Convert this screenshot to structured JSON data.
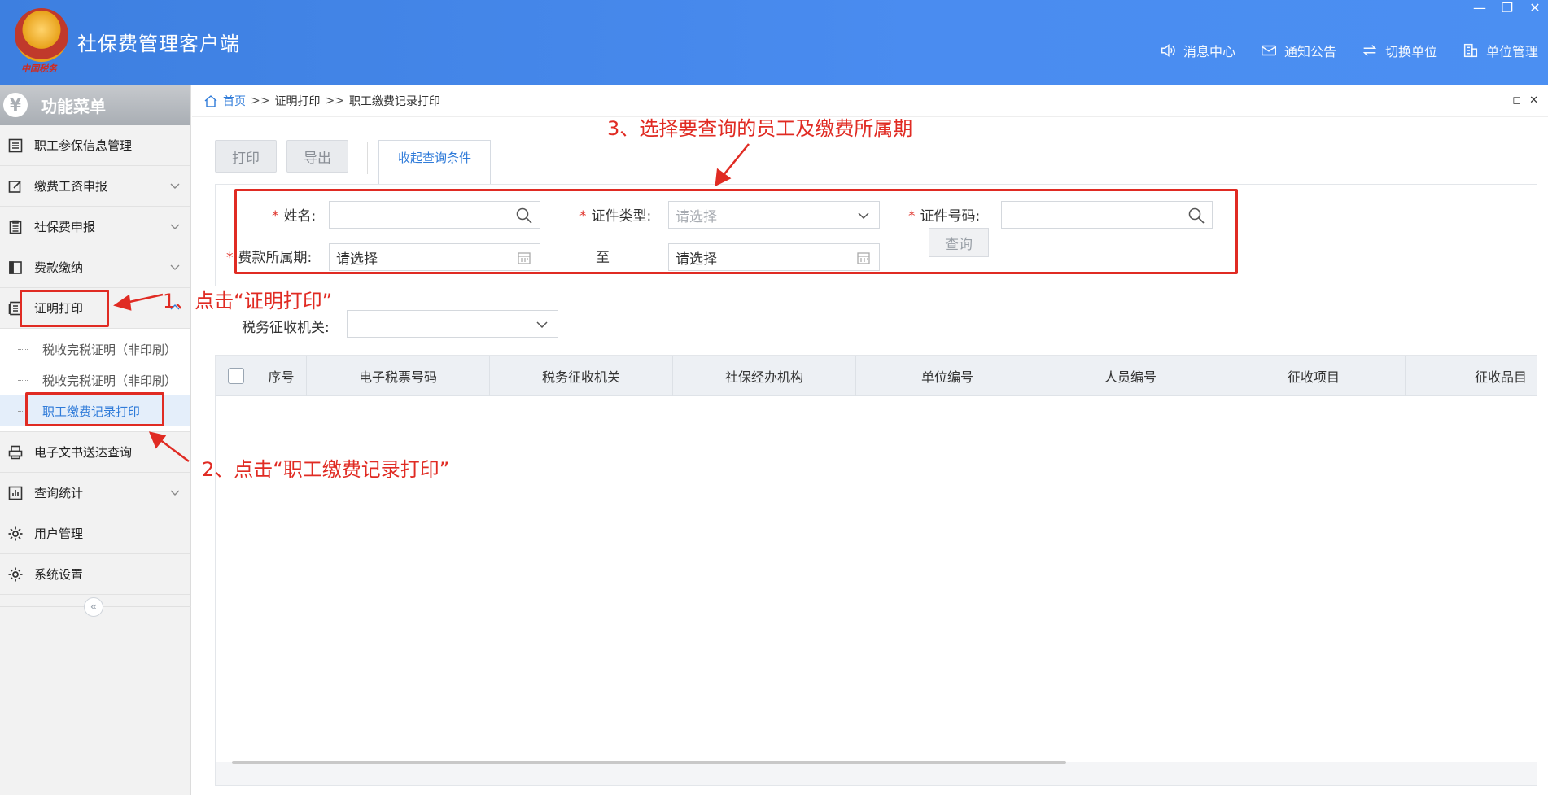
{
  "app": {
    "title": "社保费管理客户端",
    "emblem_text": "中国税务"
  },
  "window_controls": {
    "minimize": "—",
    "restore": "❐",
    "close": "✕"
  },
  "header_nav": [
    {
      "label": "消息中心",
      "icon": "speaker-icon"
    },
    {
      "label": "通知公告",
      "icon": "mail-icon"
    },
    {
      "label": "切换单位",
      "icon": "switch-icon"
    },
    {
      "label": "单位管理",
      "icon": "building-icon"
    }
  ],
  "sidebar": {
    "title": "功能菜单",
    "title_icon": "¥",
    "items": [
      {
        "label": "职工参保信息管理",
        "icon": "list-icon"
      },
      {
        "label": "缴费工资申报",
        "icon": "edit-icon"
      },
      {
        "label": "社保费申报",
        "icon": "clipboard-icon"
      },
      {
        "label": "费款缴纳",
        "icon": "book-icon"
      },
      {
        "label": "证明打印",
        "icon": "document-icon"
      },
      {
        "label": "电子文书送达查询",
        "icon": "printer-icon"
      },
      {
        "label": "查询统计",
        "icon": "chart-icon"
      },
      {
        "label": "用户管理",
        "icon": "gear-icon"
      },
      {
        "label": "系统设置",
        "icon": "gear-icon"
      }
    ],
    "submenu": [
      "税收完税证明（非印刷）",
      "税收完税证明（非印刷）",
      "职工缴费记录打印"
    ],
    "collapse": "«"
  },
  "breadcrumb": {
    "home": "首页",
    "sep": ">>",
    "level1": "证明打印",
    "level2": "职工缴费记录打印"
  },
  "panel_controls": {
    "maximize": "◻",
    "close": "✕"
  },
  "toolbar": {
    "print": "打印",
    "export": "导出",
    "toggle_query": "收起查询条件"
  },
  "query": {
    "required_mark": "*",
    "name_label": "姓名:",
    "id_type_label": "证件类型:",
    "id_type_placeholder": "请选择",
    "id_no_label": "证件号码:",
    "period_label": "费款所属期:",
    "period_from": "请选择",
    "to_label": "至",
    "period_to": "请选择",
    "query_button": "查询",
    "tax_office_label": "税务征收机关:"
  },
  "table": {
    "columns": [
      "序号",
      "电子税票号码",
      "税务征收机关",
      "社保经办机构",
      "单位编号",
      "人员编号",
      "征收项目",
      "征收品目"
    ]
  },
  "annotations": {
    "step1": "1、点击“证明打印”",
    "step2": "2、点击“职工缴费记录打印”",
    "step3": "3、选择要查询的员工及缴费所属期",
    "color": "#e02b23"
  }
}
